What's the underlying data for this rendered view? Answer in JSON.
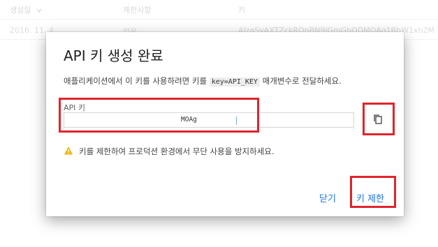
{
  "table": {
    "headers": {
      "created": "생성일",
      "restriction": "제한사항",
      "key": "키"
    },
    "row": {
      "created": "2016. 11. 4.",
      "restriction": "없음",
      "key": "AIzaSyAXTZckRQnBN9iGmGbQDMOAq1BhW1xh2M"
    }
  },
  "dialog": {
    "title": "API 키 생성 완료",
    "description_before": "애플리케이션에서 이 키를 사용하려면 키를 ",
    "description_code": "key=API_KEY",
    "description_after": " 매개변수로 전달하세요.",
    "field_label": "API 키",
    "field_value": "MOAg",
    "warning_text": "키를 제한하여 프로덕션 환경에서 무단 사용을 방지하세요.",
    "close_label": "닫기",
    "restrict_label": "키 제한"
  },
  "colors": {
    "accent": "#1a73e8",
    "highlight": "#e0242c",
    "warning": "#f4b400"
  },
  "icons": {
    "sort": "arrow-down-icon",
    "copy": "copy-icon",
    "warning": "warning-icon"
  }
}
